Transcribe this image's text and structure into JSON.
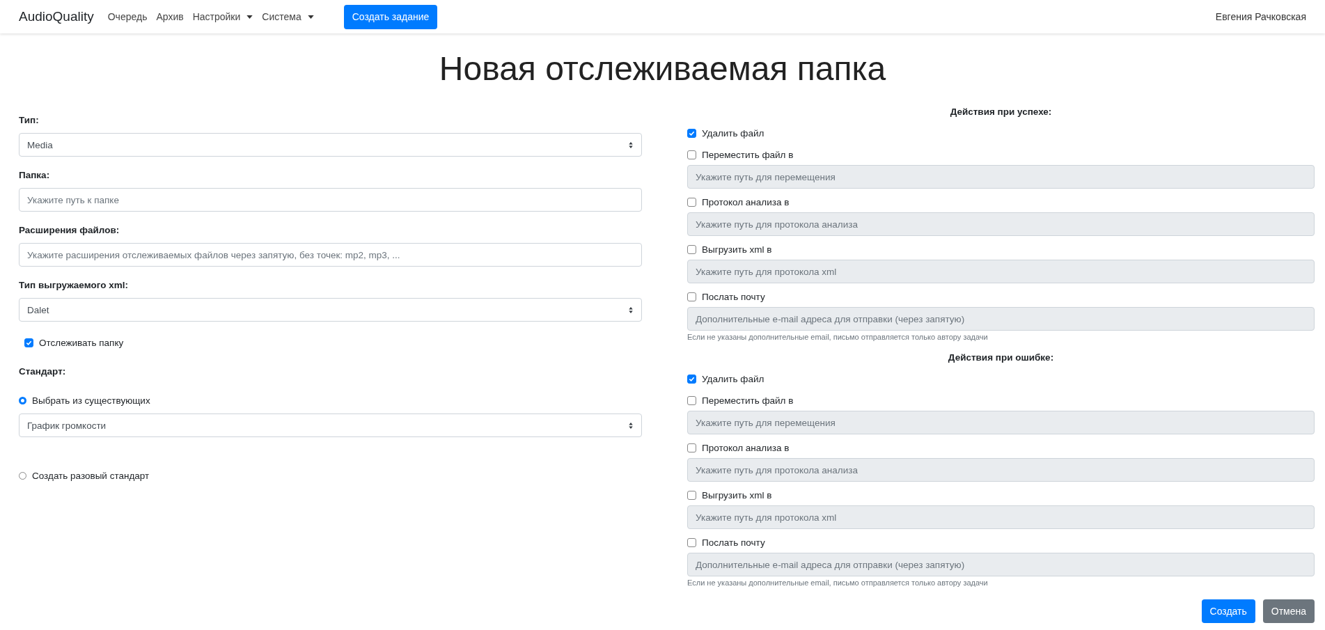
{
  "navbar": {
    "brand": "AudioQuality",
    "links": [
      {
        "label": "Очередь",
        "dropdown": false
      },
      {
        "label": "Архив",
        "dropdown": false
      },
      {
        "label": "Настройки",
        "dropdown": true
      },
      {
        "label": "Система",
        "dropdown": true
      }
    ],
    "create_button": "Создать задание",
    "user": "Евгения Рачковская"
  },
  "title": "Новая отслеживаемая папка",
  "left": {
    "fields": [
      {
        "kind": "select",
        "label": "Тип:",
        "value": "Media"
      },
      {
        "kind": "input",
        "label": "Папка:",
        "placeholder": "Укажите путь к папке"
      },
      {
        "kind": "input",
        "label": "Расширения файлов:",
        "placeholder": "Укажите расширения отслеживаемых файлов через запятую, без точек: mp2, mp3, ..."
      },
      {
        "kind": "select",
        "label": "Тип выгружаемого xml:",
        "value": "Dalet"
      }
    ],
    "watch": {
      "label": "Отслеживать папку",
      "checked": true
    },
    "standard": {
      "label": "Стандарт:",
      "options": [
        {
          "label": "Выбрать из существующих",
          "selected": true,
          "select_value": "График громкости"
        },
        {
          "label": "Создать разовый стандарт",
          "selected": false
        }
      ]
    }
  },
  "right": {
    "sections": [
      {
        "heading": "Действия при успехе:",
        "actions": [
          {
            "label": "Удалить файл",
            "checked": true
          },
          {
            "label": "Переместить файл в",
            "checked": false,
            "placeholder": "Укажите путь для перемещения",
            "disabled": true
          },
          {
            "label": "Протокол анализа в",
            "checked": false,
            "placeholder": "Укажите путь для протокола анализа",
            "disabled": true
          },
          {
            "label": "Выгрузить xml в",
            "checked": false,
            "placeholder": "Укажите путь для протокола xml",
            "disabled": true
          },
          {
            "label": "Послать почту",
            "checked": false,
            "placeholder": "Дополнительные e-mail адреса для отправки (через запятую)",
            "disabled": true
          }
        ],
        "note": "Если не указаны дополнительные email, письмо отправляется только автору задачи"
      },
      {
        "heading": "Действия при ошибке:",
        "actions": [
          {
            "label": "Удалить файл",
            "checked": true
          },
          {
            "label": "Переместить файл в",
            "checked": false,
            "placeholder": "Укажите путь для перемещения",
            "disabled": true
          },
          {
            "label": "Протокол анализа в",
            "checked": false,
            "placeholder": "Укажите путь для протокола анализа",
            "disabled": true
          },
          {
            "label": "Выгрузить xml в",
            "checked": false,
            "placeholder": "Укажите путь для протокола xml",
            "disabled": true
          },
          {
            "label": "Послать почту",
            "checked": false,
            "placeholder": "Дополнительные e-mail адреса для отправки (через запятую)",
            "disabled": true
          }
        ],
        "note": "Если не указаны дополнительные email, письмо отправляется только автору задачи"
      }
    ]
  },
  "buttons": [
    {
      "label": "Создать",
      "kind": "primary"
    },
    {
      "label": "Отмена",
      "kind": "secondary"
    }
  ]
}
